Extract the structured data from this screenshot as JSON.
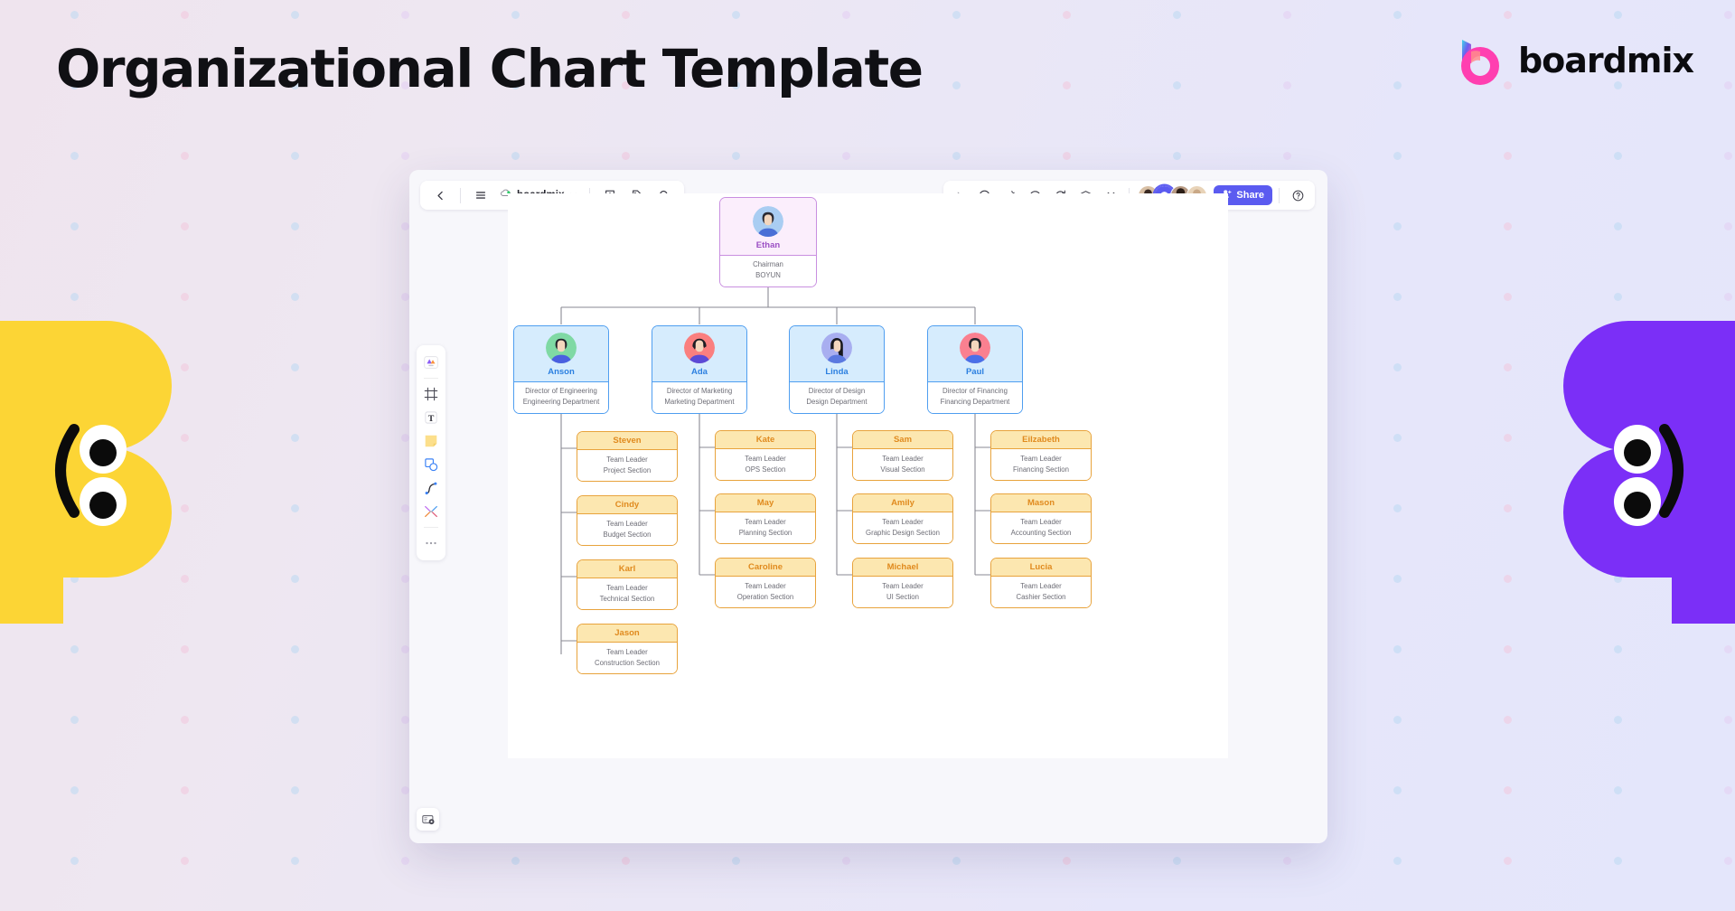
{
  "page": {
    "title": "Organizational Chart Template",
    "brand_name": "boardmix",
    "accent": "#5b5bf0",
    "mascot_left_color": "#fcd535",
    "mascot_right_color": "#7b2ff7"
  },
  "app": {
    "toolbar_left": {
      "back_icon": "chevron-left-icon",
      "menu_icon": "hamburger-menu-icon",
      "cloud_icon": "cloud-saved-icon",
      "file_name": "boardmix",
      "file_dropdown_icon": "chevron-down-icon",
      "export_icon": "export-download-icon",
      "tag_icon": "tag-icon",
      "search_icon": "search-icon"
    },
    "toolbar_right": {
      "expand_icon": "chevron-right-icon",
      "present_icon": "play-present-icon",
      "celebrate_icon": "party-popper-icon",
      "comment_icon": "comment-bubble-icon",
      "history_icon": "version-history-icon",
      "vote_icon": "vote-bank-icon",
      "more_icon": "double-chevron-down-icon",
      "collaborators": [
        "collaborator-1",
        "collaborator-2",
        "collaborator-3",
        "collaborator-4"
      ],
      "share_label": "Share",
      "share_icon": "person-add-icon",
      "help_icon": "help-question-icon"
    },
    "left_tools": [
      {
        "name": "select-cursor-tool",
        "icon": "color-cards-icon"
      },
      {
        "name": "frame-tool",
        "icon": "frame-icon"
      },
      {
        "name": "text-tool",
        "icon": "text-T-icon"
      },
      {
        "name": "sticky-note-tool",
        "icon": "sticky-note-icon"
      },
      {
        "name": "shape-tool",
        "icon": "shapes-icon"
      },
      {
        "name": "pen-tool",
        "icon": "curve-pen-icon"
      },
      {
        "name": "connector-tool",
        "icon": "connector-icon"
      },
      {
        "name": "more-tools",
        "icon": "ellipsis-icon"
      }
    ],
    "bottom_left_button": {
      "name": "minimap-button",
      "icon": "minimap-icon"
    }
  },
  "chart_data": {
    "type": "org-chart",
    "title": "Organizational Chart Template",
    "levels": [
      "Chairman",
      "Director",
      "Team Leader"
    ],
    "colors": {
      "root_border": "#c98fe0",
      "root_fill": "#fbeefc",
      "root_text": "#9b4fc4",
      "director_border": "#4f9ef0",
      "director_fill": "#d6ecfd",
      "director_text": "#2b7fe0",
      "leader_border": "#e8a33c",
      "leader_fill": "#fce7b0",
      "leader_text": "#e08a1e",
      "edge": "#8a8a93"
    },
    "root": {
      "name": "Ethan",
      "title": "Chairman",
      "unit": "BOYUN",
      "avatar": "avatar-male-dark-hair-blue-shirt"
    },
    "directors": [
      {
        "name": "Anson",
        "title": "Director of Engineering",
        "unit": "Engineering Department",
        "avatar": "avatar-male-green-bg",
        "reports": [
          {
            "name": "Steven",
            "title": "Team Leader",
            "unit": "Project Section"
          },
          {
            "name": "Cindy",
            "title": "Team Leader",
            "unit": "Budget Section"
          },
          {
            "name": "Karl",
            "title": "Team Leader",
            "unit": "Technical Section"
          },
          {
            "name": "Jason",
            "title": "Team Leader",
            "unit": "Construction Section"
          }
        ]
      },
      {
        "name": "Ada",
        "title": "Director of Marketing",
        "unit": "Marketing Department",
        "avatar": "avatar-female-red-bg",
        "reports": [
          {
            "name": "Kate",
            "title": "Team Leader",
            "unit": "OPS Section"
          },
          {
            "name": "May",
            "title": "Team Leader",
            "unit": "Planning Section"
          },
          {
            "name": "Caroline",
            "title": "Team Leader",
            "unit": "Operation Section"
          }
        ]
      },
      {
        "name": "Linda",
        "title": "Director of Design",
        "unit": "Design Department",
        "avatar": "avatar-female-long-hair-periwinkle-bg",
        "reports": [
          {
            "name": "Sam",
            "title": "Team Leader",
            "unit": "Visual Section"
          },
          {
            "name": "Amily",
            "title": "Team Leader",
            "unit": "Graphic Design Section"
          },
          {
            "name": "Michael",
            "title": "Team Leader",
            "unit": "UI Section"
          }
        ]
      },
      {
        "name": "Paul",
        "title": "Director of Financing",
        "unit": "Financing Department",
        "avatar": "avatar-male-pink-bg",
        "reports": [
          {
            "name": "Eilzabeth",
            "title": "Team Leader",
            "unit": "Financing Section"
          },
          {
            "name": "Mason",
            "title": "Team Leader",
            "unit": "Accounting Section"
          },
          {
            "name": "Lucia",
            "title": "Team Leader",
            "unit": "Cashier Section"
          }
        ]
      }
    ]
  }
}
